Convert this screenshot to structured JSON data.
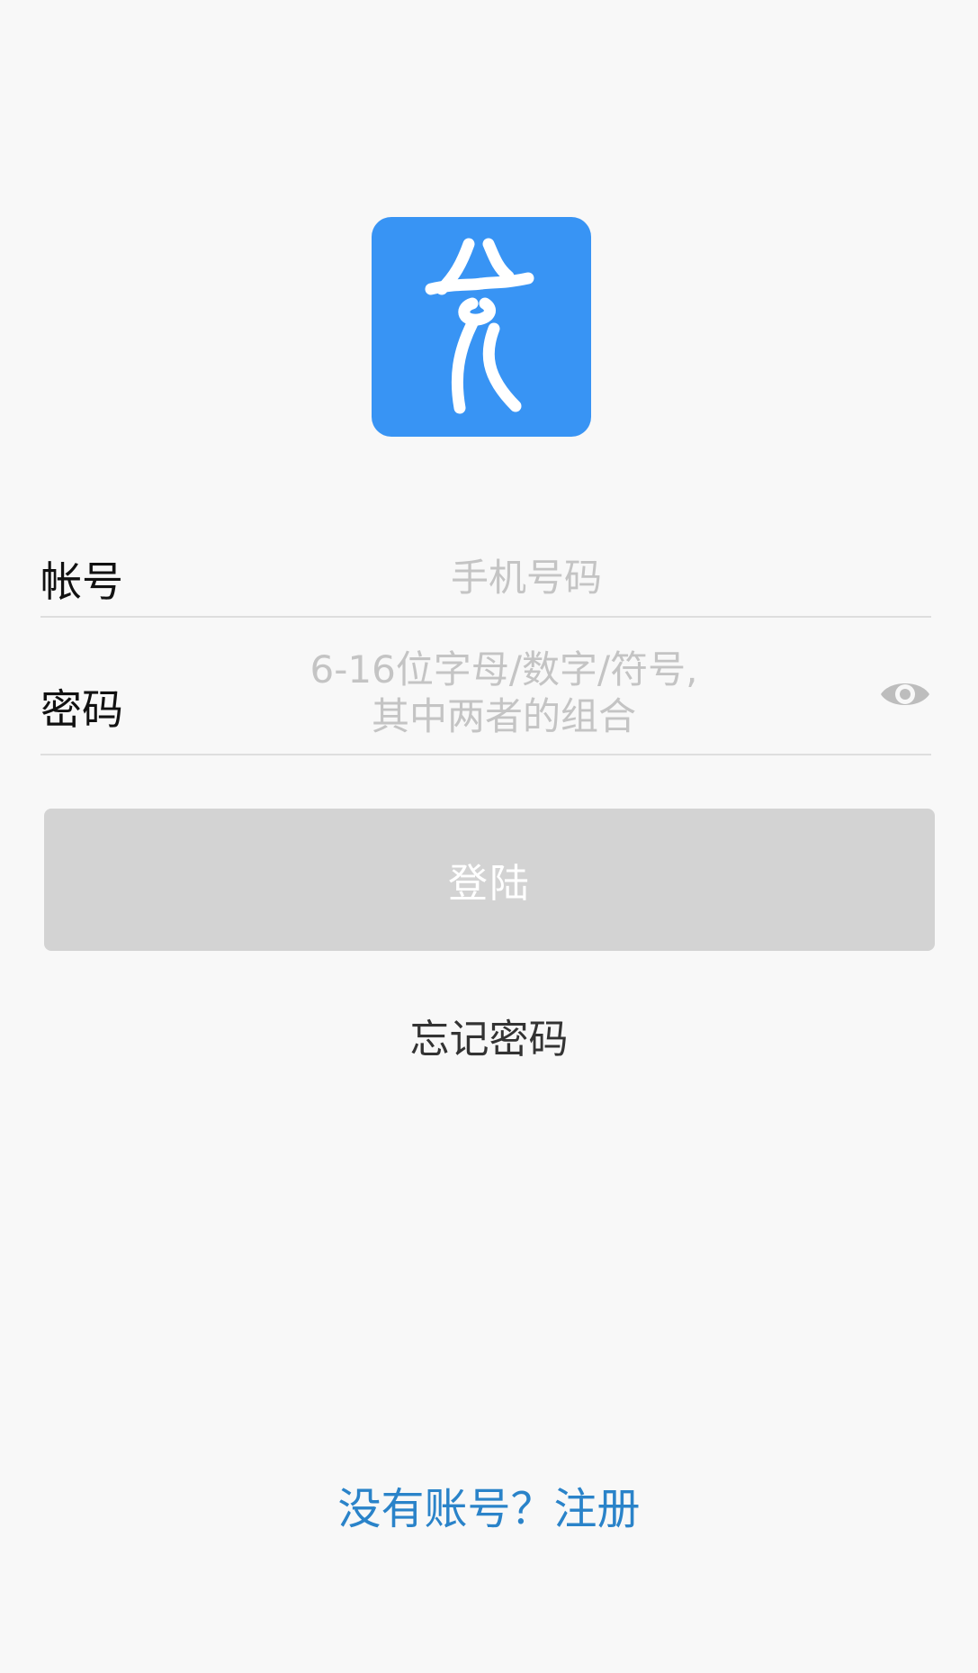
{
  "logo": {
    "icon": "app-logo-icon",
    "bg_color": "#3894f4"
  },
  "account": {
    "label": "帐号",
    "placeholder": "手机号码"
  },
  "password": {
    "label": "密码",
    "placeholder_line1": "6-16位字母/数字/符号,",
    "placeholder_line2": "其中两者的组合",
    "toggle_icon": "eye-icon"
  },
  "login_button": {
    "label": "登陆",
    "bg_color": "#d3d3d3"
  },
  "forgot_link": {
    "label": "忘记密码"
  },
  "register_link": {
    "label": "没有账号？注册",
    "color": "#2a83c9"
  }
}
